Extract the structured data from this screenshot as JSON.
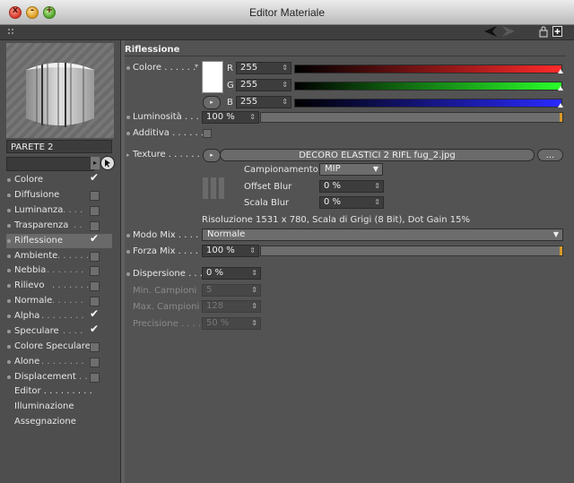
{
  "window": {
    "title": "Editor Materiale",
    "close_glyph": "x",
    "min_glyph": "-",
    "max_glyph": "+"
  },
  "toolbar": {
    "grip_icon": "grip-icon",
    "back_icon": "arrow-left-icon",
    "lock_icon": "lock-icon",
    "new_icon": "add-window-icon"
  },
  "material": {
    "name": "PARETE 2"
  },
  "channels": [
    {
      "label": "Colore",
      "dots": "",
      "checked": true
    },
    {
      "label": "Diffusione",
      "dots": "",
      "checked": false
    },
    {
      "label": "Luminanza",
      "dots": " . . . .",
      "checked": false
    },
    {
      "label": "Trasparenza",
      "dots": ". .",
      "checked": false
    },
    {
      "label": "Riflessione",
      "dots": "",
      "checked": true,
      "selected": true
    },
    {
      "label": "Ambiente",
      "dots": " . . . . . .",
      "checked": false
    },
    {
      "label": "Nebbia",
      "dots": " . . . . . . .",
      "checked": false
    },
    {
      "label": "Rilievo",
      "dots": " . . . . . . .",
      "checked": false
    },
    {
      "label": "Normale",
      "dots": " . . . . . .",
      "checked": false
    },
    {
      "label": "Alpha",
      "dots": " . . . . . . . .",
      "checked": true
    },
    {
      "label": "Speculare",
      "dots": " . . . .",
      "checked": true
    },
    {
      "label": "Colore Speculare",
      "dots": "",
      "checked": false
    },
    {
      "label": "Alone",
      "dots": " . . . . . . . .",
      "checked": false
    },
    {
      "label": "Displacement",
      "dots": " . .",
      "checked": false
    }
  ],
  "extra_items": [
    "Editor . . . . . . . . .",
    "Illuminazione",
    "Assegnazione"
  ],
  "section": {
    "title": "Riflessione"
  },
  "colore": {
    "label": "Colore . . . . . .",
    "r_label": "R",
    "g_label": "G",
    "b_label": "B",
    "r": "255",
    "g": "255",
    "b": "255",
    "swatch_color": "#ffffff",
    "btn_glyph": "▸"
  },
  "luminosita": {
    "label": "Luminosità . . . .",
    "value": "100 %"
  },
  "additiva": {
    "label": "Additiva . . . . . ."
  },
  "texture": {
    "label": "Texture . . . . . . .",
    "file": "DECORO ELASTICI 2 RIFL fug_2.jpg",
    "more_button": "...",
    "campionamento_label": "Campionamento",
    "campionamento_value": "MIP",
    "offset_blur_label": "Offset Blur",
    "offset_blur_value": "0 %",
    "scala_blur_label": "Scala Blur",
    "scala_blur_value": "0 %",
    "info": "Risoluzione 1531 x 780, Scala di Grigi (8 Bit), Dot Gain 15%"
  },
  "modo_mix": {
    "label": "Modo Mix . . . . .",
    "value": "Normale"
  },
  "forza_mix": {
    "label": "Forza Mix . . . . .",
    "value": "100 %"
  },
  "dispersione": {
    "label": "Dispersione . . . .",
    "value": "0 %",
    "min_campioni_label": "Min. Campioni",
    "min_campioni_value": "5",
    "max_campioni_label": "Max. Campioni",
    "max_campioni_value": "128",
    "precisione_label": "Precisione . . . .",
    "precisione_value": "50 %"
  },
  "colors": {
    "accent_orange": "#d89a2a",
    "panel_bg": "#535353"
  }
}
